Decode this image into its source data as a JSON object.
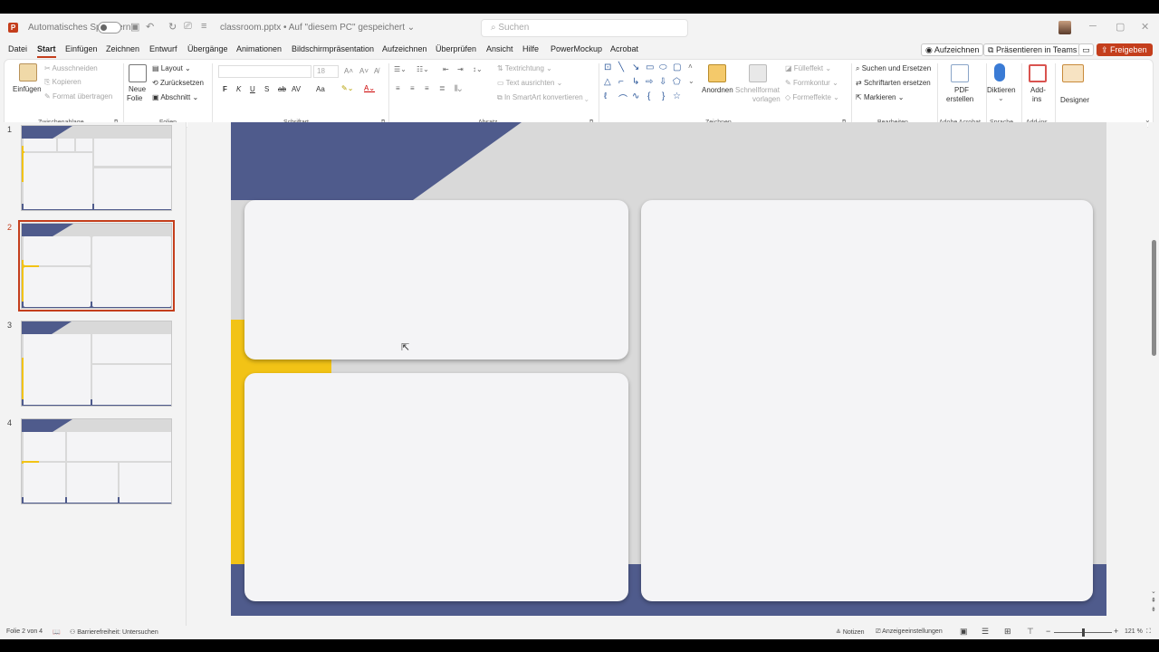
{
  "titlebar": {
    "autosave_label": "Automatisches Speichern",
    "filename": "classroom.pptx • Auf \"diesem PC\" gespeichert ⌄",
    "search_placeholder": "Suchen"
  },
  "menu": {
    "items": [
      "Datei",
      "Start",
      "Einfügen",
      "Zeichnen",
      "Entwurf",
      "Übergänge",
      "Animationen",
      "Bildschirmpräsentation",
      "Aufzeichnen",
      "Überprüfen",
      "Ansicht",
      "Hilfe",
      "PowerMockup",
      "Acrobat"
    ],
    "active": "Start",
    "record_btn": "Aufzeichnen",
    "teams_btn": "Präsentieren in Teams",
    "share_btn": "Freigeben"
  },
  "ribbon": {
    "clipboard": {
      "paste": "Einfügen",
      "cut": "Ausschneiden",
      "copy": "Kopieren",
      "format_painter": "Format übertragen",
      "group": "Zwischenablage"
    },
    "slides": {
      "new_slide_1": "Neue",
      "new_slide_2": "Folie",
      "layout": "Layout",
      "reset": "Zurücksetzen",
      "section": "Abschnitt",
      "group": "Folien"
    },
    "font": {
      "size": "18",
      "bold": "F",
      "italic": "K",
      "underline": "U",
      "strike": "S",
      "strike2": "ab",
      "spacing": "AV",
      "case": "Aa",
      "group": "Schriftart"
    },
    "paragraph": {
      "direction": "Textrichtung",
      "align_text": "Text ausrichten",
      "smartart": "In SmartArt konvertieren",
      "group": "Absatz"
    },
    "drawing": {
      "arrange": "Anordnen",
      "quick_styles_1": "Schnellformat",
      "quick_styles_2": "vorlagen",
      "fill": "Fülleffekt",
      "outline": "Formkontur",
      "effects": "Formeffekte",
      "group": "Zeichnen"
    },
    "editing": {
      "find": "Suchen und Ersetzen",
      "replace_fonts": "Schriftarten ersetzen",
      "select": "Markieren",
      "group": "Bearbeiten"
    },
    "acrobat": {
      "pdf_1": "PDF",
      "pdf_2": "erstellen",
      "group": "Adobe Acrobat"
    },
    "voice": {
      "dictate": "Diktieren",
      "group": "Sprache"
    },
    "addins": {
      "label_1": "Add-",
      "label_2": "ins",
      "group": "Add-ins"
    },
    "designer": {
      "label": "Designer"
    }
  },
  "slides": [
    {
      "number": "1"
    },
    {
      "number": "2"
    },
    {
      "number": "3"
    },
    {
      "number": "4"
    }
  ],
  "selected_slide": "2",
  "colors": {
    "navy": "#4f5b8c",
    "yellow": "#f2c316",
    "slide_bg": "#d9d9d9",
    "card": "#f4f4f6",
    "accent": "#c43e1c"
  },
  "status": {
    "slide_info": "Folie 2 von 4",
    "accessibility": "Barrierefreiheit: Untersuchen",
    "notes": "Notizen",
    "display_settings": "Anzeigeeinstellungen",
    "zoom": "121 %"
  }
}
